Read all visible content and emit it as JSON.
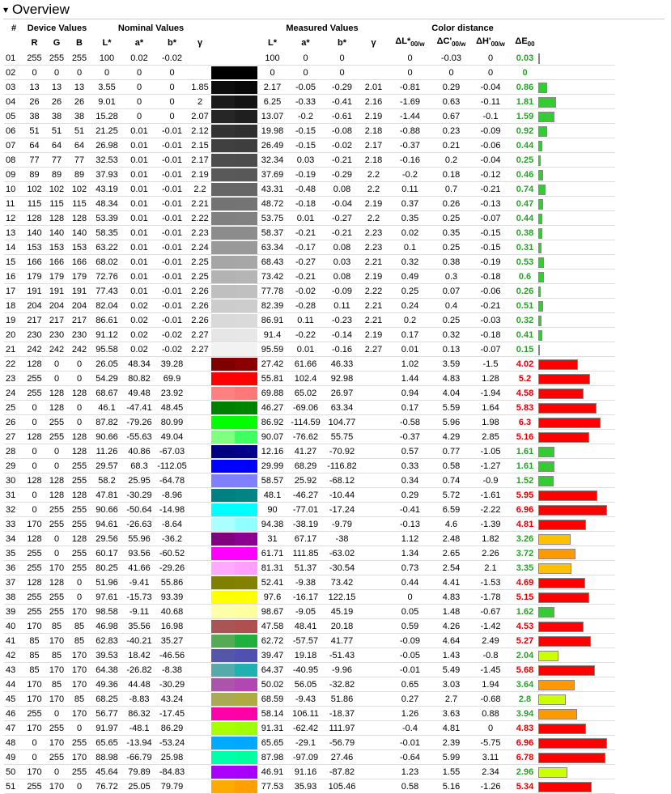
{
  "section": {
    "title": "Overview",
    "arrow": "▾"
  },
  "groups": {
    "device": "Device Values",
    "nominal": "Nominal Values",
    "measured": "Measured Values",
    "distance": "Color distance"
  },
  "cols": {
    "num": "#",
    "r": "R",
    "g": "G",
    "b": "B",
    "nl": "L*",
    "na": "a*",
    "nb": "b*",
    "ng": "γ",
    "ml": "L*",
    "ma": "a*",
    "mb": "b*",
    "mg": "γ",
    "dl": "ΔL*",
    "dc": "ΔC'",
    "dh": "ΔH'",
    "de": "ΔE",
    "sub_w": "00/w",
    "sub": "00"
  },
  "rows": [
    [
      "01",
      "255",
      "255",
      "255",
      "100",
      "0.02",
      "-0.02",
      "",
      "100",
      "0",
      "0",
      "",
      "0",
      "-0.03",
      "0",
      "0.03",
      "#ffffff",
      "#ffffff"
    ],
    [
      "02",
      "0",
      "0",
      "0",
      "0",
      "0",
      "0",
      "",
      "0",
      "0",
      "0",
      "",
      "0",
      "0",
      "0",
      "0",
      "#000000",
      "#000000"
    ],
    [
      "03",
      "13",
      "13",
      "13",
      "3.55",
      "0",
      "0",
      "1.85",
      "2.17",
      "-0.05",
      "-0.29",
      "2.01",
      "-0.81",
      "0.29",
      "-0.04",
      "0.86",
      "#0d0d0d",
      "#080808"
    ],
    [
      "04",
      "26",
      "26",
      "26",
      "9.01",
      "0",
      "0",
      "2",
      "6.25",
      "-0.33",
      "-0.41",
      "2.16",
      "-1.69",
      "0.63",
      "-0.11",
      "1.81",
      "#1a1a1a",
      "#131313"
    ],
    [
      "05",
      "38",
      "38",
      "38",
      "15.28",
      "0",
      "0",
      "2.07",
      "13.07",
      "-0.2",
      "-0.61",
      "2.19",
      "-1.44",
      "0.67",
      "-0.1",
      "1.59",
      "#262626",
      "#1f1f20"
    ],
    [
      "06",
      "51",
      "51",
      "51",
      "21.25",
      "0.01",
      "-0.01",
      "2.12",
      "19.98",
      "-0.15",
      "-0.08",
      "2.18",
      "-0.88",
      "0.23",
      "-0.09",
      "0.92",
      "#333333",
      "#2f2f2f"
    ],
    [
      "07",
      "64",
      "64",
      "64",
      "26.98",
      "0.01",
      "-0.01",
      "2.15",
      "26.49",
      "-0.15",
      "-0.02",
      "2.17",
      "-0.37",
      "0.21",
      "-0.06",
      "0.44",
      "#404040",
      "#3e3e3e"
    ],
    [
      "08",
      "77",
      "77",
      "77",
      "32.53",
      "0.01",
      "-0.01",
      "2.17",
      "32.34",
      "0.03",
      "-0.21",
      "2.18",
      "-0.16",
      "0.2",
      "-0.04",
      "0.25",
      "#4d4d4d",
      "#4c4c4c"
    ],
    [
      "09",
      "89",
      "89",
      "89",
      "37.93",
      "0.01",
      "-0.01",
      "2.19",
      "37.69",
      "-0.19",
      "-0.29",
      "2.2",
      "-0.2",
      "0.18",
      "-0.12",
      "0.46",
      "#595959",
      "#585859"
    ],
    [
      "10",
      "102",
      "102",
      "102",
      "43.19",
      "0.01",
      "-0.01",
      "2.2",
      "43.31",
      "-0.48",
      "0.08",
      "2.2",
      "0.11",
      "0.7",
      "-0.21",
      "0.74",
      "#666666",
      "#666666"
    ],
    [
      "11",
      "115",
      "115",
      "115",
      "48.34",
      "0.01",
      "-0.01",
      "2.21",
      "48.72",
      "-0.18",
      "-0.04",
      "2.19",
      "0.37",
      "0.26",
      "-0.13",
      "0.47",
      "#737373",
      "#747474"
    ],
    [
      "12",
      "128",
      "128",
      "128",
      "53.39",
      "0.01",
      "-0.01",
      "2.22",
      "53.75",
      "0.01",
      "-0.27",
      "2.2",
      "0.35",
      "0.25",
      "-0.07",
      "0.44",
      "#808080",
      "#818182"
    ],
    [
      "13",
      "140",
      "140",
      "140",
      "58.35",
      "0.01",
      "-0.01",
      "2.23",
      "58.37",
      "-0.21",
      "-0.21",
      "2.23",
      "0.02",
      "0.35",
      "-0.15",
      "0.38",
      "#8c8c8c",
      "#8c8c8d"
    ],
    [
      "14",
      "153",
      "153",
      "153",
      "63.22",
      "0.01",
      "-0.01",
      "2.24",
      "63.34",
      "-0.17",
      "0.08",
      "2.23",
      "0.1",
      "0.25",
      "-0.15",
      "0.31",
      "#999999",
      "#999999"
    ],
    [
      "15",
      "166",
      "166",
      "166",
      "68.02",
      "0.01",
      "-0.01",
      "2.25",
      "68.43",
      "-0.27",
      "0.03",
      "2.21",
      "0.32",
      "0.38",
      "-0.19",
      "0.53",
      "#a6a6a6",
      "#a7a7a7"
    ],
    [
      "16",
      "179",
      "179",
      "179",
      "72.76",
      "0.01",
      "-0.01",
      "2.25",
      "73.42",
      "-0.21",
      "0.08",
      "2.19",
      "0.49",
      "0.3",
      "-0.18",
      "0.6",
      "#b3b3b3",
      "#b5b5b5"
    ],
    [
      "17",
      "191",
      "191",
      "191",
      "77.43",
      "0.01",
      "-0.01",
      "2.26",
      "77.78",
      "-0.02",
      "-0.09",
      "2.22",
      "0.25",
      "0.07",
      "-0.06",
      "0.26",
      "#bfbfbf",
      "#c0c0c0"
    ],
    [
      "18",
      "204",
      "204",
      "204",
      "82.04",
      "0.02",
      "-0.01",
      "2.26",
      "82.39",
      "-0.28",
      "0.11",
      "2.21",
      "0.24",
      "0.4",
      "-0.21",
      "0.51",
      "#cccccc",
      "#cdcdcd"
    ],
    [
      "19",
      "217",
      "217",
      "217",
      "86.61",
      "0.02",
      "-0.01",
      "2.26",
      "86.91",
      "0.11",
      "-0.23",
      "2.21",
      "0.2",
      "0.25",
      "-0.03",
      "0.32",
      "#d9d9d9",
      "#dadada"
    ],
    [
      "20",
      "230",
      "230",
      "230",
      "91.12",
      "0.02",
      "-0.02",
      "2.27",
      "91.4",
      "-0.22",
      "-0.14",
      "2.19",
      "0.17",
      "0.32",
      "-0.18",
      "0.41",
      "#e6e6e6",
      "#e7e7e7"
    ],
    [
      "21",
      "242",
      "242",
      "242",
      "95.58",
      "0.02",
      "-0.02",
      "2.27",
      "95.59",
      "0.01",
      "-0.16",
      "2.27",
      "0.01",
      "0.13",
      "-0.07",
      "0.15",
      "#f2f2f2",
      "#f2f2f2"
    ],
    [
      "22",
      "128",
      "0",
      "0",
      "26.05",
      "48.34",
      "39.28",
      "",
      "27.42",
      "61.66",
      "46.33",
      "",
      "1.02",
      "3.59",
      "-1.5",
      "4.02",
      "#800000",
      "#8b0000"
    ],
    [
      "23",
      "255",
      "0",
      "0",
      "54.29",
      "80.82",
      "69.9",
      "",
      "55.81",
      "102.4",
      "92.98",
      "",
      "1.44",
      "4.83",
      "1.28",
      "5.2",
      "#ff0000",
      "#ff0000"
    ],
    [
      "24",
      "255",
      "128",
      "128",
      "68.67",
      "49.48",
      "23.92",
      "",
      "69.88",
      "65.02",
      "26.97",
      "",
      "0.94",
      "4.04",
      "-1.94",
      "4.58",
      "#ff8080",
      "#ff7878"
    ],
    [
      "25",
      "0",
      "128",
      "0",
      "46.1",
      "-47.41",
      "48.45",
      "",
      "46.27",
      "-69.06",
      "63.34",
      "",
      "0.17",
      "5.59",
      "1.64",
      "5.83",
      "#008000",
      "#008500"
    ],
    [
      "26",
      "0",
      "255",
      "0",
      "87.82",
      "-79.26",
      "80.99",
      "",
      "86.92",
      "-114.59",
      "104.77",
      "",
      "-0.58",
      "5.96",
      "1.98",
      "6.3",
      "#00ff00",
      "#00ff00"
    ],
    [
      "27",
      "128",
      "255",
      "128",
      "90.66",
      "-55.63",
      "49.04",
      "",
      "90.07",
      "-76.62",
      "55.75",
      "",
      "-0.37",
      "4.29",
      "2.85",
      "5.16",
      "#80ff80",
      "#40ff60"
    ],
    [
      "28",
      "0",
      "0",
      "128",
      "11.26",
      "40.86",
      "-67.03",
      "",
      "12.16",
      "41.27",
      "-70.92",
      "",
      "0.57",
      "0.77",
      "-1.05",
      "1.61",
      "#000080",
      "#000088"
    ],
    [
      "29",
      "0",
      "0",
      "255",
      "29.57",
      "68.3",
      "-112.05",
      "",
      "29.99",
      "68.29",
      "-116.82",
      "",
      "0.33",
      "0.58",
      "-1.27",
      "1.61",
      "#0000ff",
      "#0000ff"
    ],
    [
      "30",
      "128",
      "128",
      "255",
      "58.2",
      "25.95",
      "-64.78",
      "",
      "58.57",
      "25.92",
      "-68.12",
      "",
      "0.34",
      "0.74",
      "-0.9",
      "1.52",
      "#8080ff",
      "#8080ff"
    ],
    [
      "31",
      "0",
      "128",
      "128",
      "47.81",
      "-30.29",
      "-8.96",
      "",
      "48.1",
      "-46.27",
      "-10.44",
      "",
      "0.29",
      "5.72",
      "-1.61",
      "5.95",
      "#008080",
      "#008484"
    ],
    [
      "32",
      "0",
      "255",
      "255",
      "90.66",
      "-50.64",
      "-14.98",
      "",
      "90",
      "-77.01",
      "-17.24",
      "",
      "-0.41",
      "6.59",
      "-2.22",
      "6.96",
      "#00ffff",
      "#00ffff"
    ],
    [
      "33",
      "170",
      "255",
      "255",
      "94.61",
      "-26.63",
      "-8.64",
      "",
      "94.38",
      "-38.19",
      "-9.79",
      "",
      "-0.13",
      "4.6",
      "-1.39",
      "4.81",
      "#aaffff",
      "#90ffff"
    ],
    [
      "34",
      "128",
      "0",
      "128",
      "29.56",
      "55.96",
      "-36.2",
      "",
      "31",
      "67.17",
      "-38",
      "",
      "1.12",
      "2.48",
      "1.82",
      "3.26",
      "#800080",
      "#8a0090"
    ],
    [
      "35",
      "255",
      "0",
      "255",
      "60.17",
      "93.56",
      "-60.52",
      "",
      "61.71",
      "111.85",
      "-63.02",
      "",
      "1.34",
      "2.65",
      "2.26",
      "3.72",
      "#ff00ff",
      "#ff00ff"
    ],
    [
      "36",
      "255",
      "170",
      "255",
      "80.25",
      "41.66",
      "-29.26",
      "",
      "81.31",
      "51.37",
      "-30.54",
      "",
      "0.73",
      "2.54",
      "2.1",
      "3.35",
      "#ffaaff",
      "#ffa0ff"
    ],
    [
      "37",
      "128",
      "128",
      "0",
      "51.96",
      "-9.41",
      "55.86",
      "",
      "52.41",
      "-9.38",
      "73.42",
      "",
      "0.44",
      "4.41",
      "-1.53",
      "4.69",
      "#808000",
      "#848000"
    ],
    [
      "38",
      "255",
      "255",
      "0",
      "97.61",
      "-15.73",
      "93.39",
      "",
      "97.6",
      "-16.17",
      "122.15",
      "",
      "0",
      "4.83",
      "-1.78",
      "5.15",
      "#ffff00",
      "#ffff00"
    ],
    [
      "39",
      "255",
      "255",
      "170",
      "98.58",
      "-9.11",
      "40.68",
      "",
      "98.67",
      "-9.05",
      "45.19",
      "",
      "0.05",
      "1.48",
      "-0.67",
      "1.62",
      "#ffffaa",
      "#ffffa0"
    ],
    [
      "40",
      "170",
      "85",
      "85",
      "46.98",
      "35.56",
      "16.98",
      "",
      "47.58",
      "48.41",
      "20.18",
      "",
      "0.59",
      "4.26",
      "-1.42",
      "4.53",
      "#aa5555",
      "#b04f50"
    ],
    [
      "41",
      "85",
      "170",
      "85",
      "62.83",
      "-40.21",
      "35.27",
      "",
      "62.72",
      "-57.57",
      "41.77",
      "",
      "-0.09",
      "4.64",
      "2.49",
      "5.27",
      "#55aa55",
      "#20b040"
    ],
    [
      "42",
      "85",
      "85",
      "170",
      "39.53",
      "18.42",
      "-46.56",
      "",
      "39.47",
      "19.18",
      "-51.43",
      "",
      "-0.05",
      "1.43",
      "-0.8",
      "2.04",
      "#5555aa",
      "#5050b0"
    ],
    [
      "43",
      "85",
      "170",
      "170",
      "64.38",
      "-26.82",
      "-8.38",
      "",
      "64.37",
      "-40.95",
      "-9.96",
      "",
      "-0.01",
      "5.49",
      "-1.45",
      "5.68",
      "#55aaaa",
      "#20b0b0"
    ],
    [
      "44",
      "170",
      "85",
      "170",
      "49.36",
      "44.48",
      "-30.29",
      "",
      "50.02",
      "56.05",
      "-32.82",
      "",
      "0.65",
      "3.03",
      "1.94",
      "3.64",
      "#aa55aa",
      "#b048b0"
    ],
    [
      "45",
      "170",
      "170",
      "85",
      "68.25",
      "-8.83",
      "43.24",
      "",
      "68.59",
      "-9.43",
      "51.86",
      "",
      "0.27",
      "2.7",
      "-0.68",
      "2.8",
      "#aaaa55",
      "#acac40"
    ],
    [
      "46",
      "255",
      "0",
      "170",
      "56.77",
      "86.32",
      "-17.45",
      "",
      "58.14",
      "106.11",
      "-18.37",
      "",
      "1.26",
      "3.63",
      "0.88",
      "3.94",
      "#ff00aa",
      "#ff00a8"
    ],
    [
      "47",
      "170",
      "255",
      "0",
      "91.97",
      "-48.1",
      "86.29",
      "",
      "91.31",
      "-62.42",
      "111.97",
      "",
      "-0.4",
      "4.81",
      "0",
      "4.83",
      "#aaff00",
      "#a0ff00"
    ],
    [
      "48",
      "0",
      "170",
      "255",
      "65.65",
      "-13.94",
      "-53.24",
      "",
      "65.65",
      "-29.1",
      "-56.79",
      "",
      "-0.01",
      "2.39",
      "-5.75",
      "6.96",
      "#00aaff",
      "#00a8ff"
    ],
    [
      "49",
      "0",
      "255",
      "170",
      "88.98",
      "-66.79",
      "25.98",
      "",
      "87.98",
      "-97.09",
      "27.46",
      "",
      "-0.64",
      "5.99",
      "3.11",
      "6.78",
      "#00ffaa",
      "#00ffa0"
    ],
    [
      "50",
      "170",
      "0",
      "255",
      "45.64",
      "79.89",
      "-84.83",
      "",
      "46.91",
      "91.16",
      "-87.82",
      "",
      "1.23",
      "1.55",
      "2.34",
      "2.96",
      "#aa00ff",
      "#a800ff"
    ],
    [
      "51",
      "255",
      "170",
      "0",
      "76.72",
      "25.05",
      "79.79",
      "",
      "77.53",
      "35.93",
      "105.46",
      "",
      "0.58",
      "5.16",
      "-1.26",
      "5.34",
      "#ffaa00",
      "#ffa000"
    ]
  ],
  "bar_colors": {
    "good": "#33cc33",
    "ok": "#ccff00",
    "warn": "#ffc000",
    "warn2": "#ff9900",
    "bad": "#ff0000"
  },
  "bar_scale_max": 7.5
}
